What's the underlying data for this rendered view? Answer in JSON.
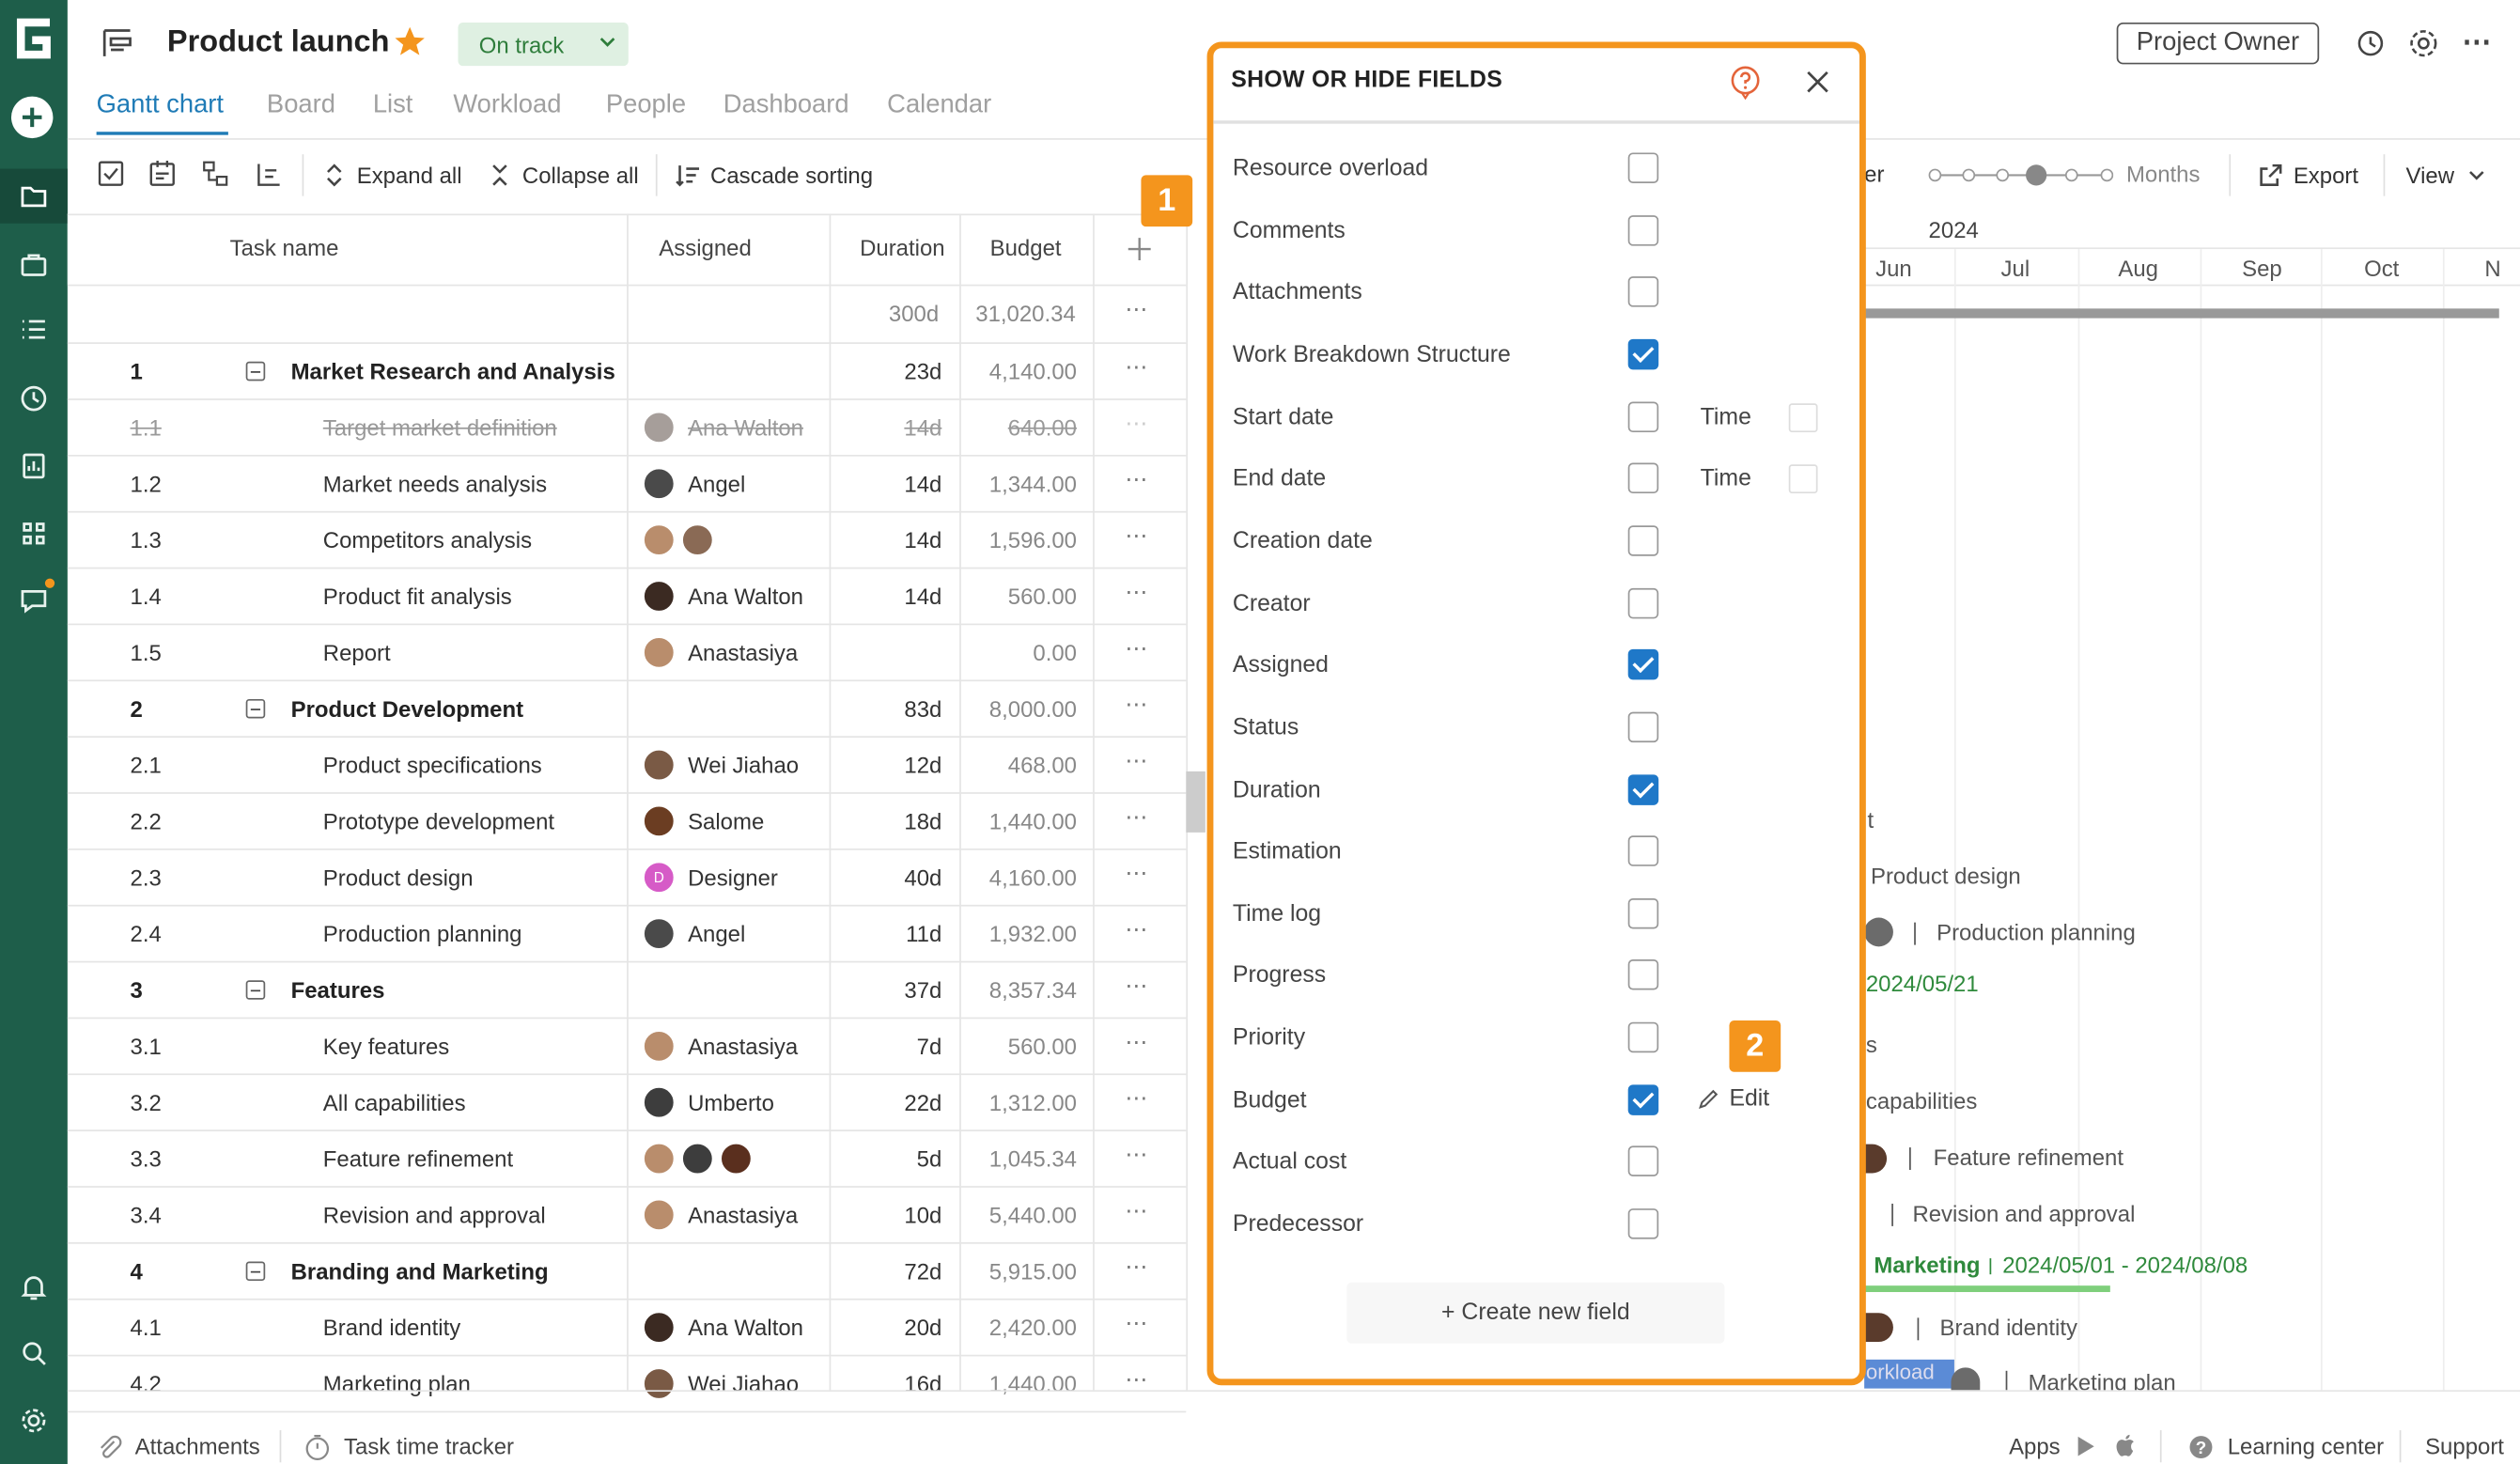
{
  "header": {
    "title": "Product launch",
    "status": "On track",
    "owner_button": "Project Owner"
  },
  "tabs": [
    "Gantt chart",
    "Board",
    "List",
    "Workload",
    "People",
    "Dashboard",
    "Calendar"
  ],
  "toolbar": {
    "expand_all": "Expand all",
    "collapse_all": "Collapse all",
    "cascade_sorting": "Cascade sorting",
    "export": "Export",
    "view": "View",
    "months": "Months",
    "filter_partial": "er"
  },
  "grid": {
    "columns": [
      "Task name",
      "Assigned",
      "Duration",
      "Budget"
    ],
    "summary": {
      "duration": "300d",
      "budget": "31,020.34"
    },
    "rows": [
      {
        "id": "1",
        "name": "Market Research and Analysis",
        "assigned": "",
        "duration": "23d",
        "budget": "4,140.00",
        "group": true
      },
      {
        "id": "1.1",
        "name": "Target market definition",
        "assigned": "Ana Walton",
        "duration": "14d",
        "budget": "640.00",
        "done": true
      },
      {
        "id": "1.2",
        "name": "Market needs analysis",
        "assigned": "Angel",
        "duration": "14d",
        "budget": "1,344.00"
      },
      {
        "id": "1.3",
        "name": "Competitors analysis",
        "assigned": "",
        "duration": "14d",
        "budget": "1,596.00"
      },
      {
        "id": "1.4",
        "name": "Product fit analysis",
        "assigned": "Ana Walton",
        "duration": "14d",
        "budget": "560.00"
      },
      {
        "id": "1.5",
        "name": "Report",
        "assigned": "Anastasiya",
        "duration": "",
        "budget": "0.00"
      },
      {
        "id": "2",
        "name": "Product Development",
        "assigned": "",
        "duration": "83d",
        "budget": "8,000.00",
        "group": true
      },
      {
        "id": "2.1",
        "name": "Product specifications",
        "assigned": "Wei Jiahao",
        "duration": "12d",
        "budget": "468.00"
      },
      {
        "id": "2.2",
        "name": "Prototype development",
        "assigned": "Salome",
        "duration": "18d",
        "budget": "1,440.00"
      },
      {
        "id": "2.3",
        "name": "Product design",
        "assigned": "Designer",
        "duration": "40d",
        "budget": "4,160.00"
      },
      {
        "id": "2.4",
        "name": "Production planning",
        "assigned": "Angel",
        "duration": "11d",
        "budget": "1,932.00"
      },
      {
        "id": "3",
        "name": "Features",
        "assigned": "",
        "duration": "37d",
        "budget": "8,357.34",
        "group": true
      },
      {
        "id": "3.1",
        "name": "Key features",
        "assigned": "Anastasiya",
        "duration": "7d",
        "budget": "560.00"
      },
      {
        "id": "3.2",
        "name": "All capabilities",
        "assigned": "Umberto",
        "duration": "22d",
        "budget": "1,312.00"
      },
      {
        "id": "3.3",
        "name": "Feature refinement",
        "assigned": "",
        "duration": "5d",
        "budget": "1,045.34"
      },
      {
        "id": "3.4",
        "name": "Revision and approval",
        "assigned": "Anastasiya",
        "duration": "10d",
        "budget": "5,440.00"
      },
      {
        "id": "4",
        "name": "Branding and Marketing",
        "assigned": "",
        "duration": "72d",
        "budget": "5,915.00",
        "group": true
      },
      {
        "id": "4.1",
        "name": "Brand identity",
        "assigned": "Ana Walton",
        "duration": "20d",
        "budget": "2,420.00"
      },
      {
        "id": "4.2",
        "name": "Marketing plan",
        "assigned": "Wei Jiahao",
        "duration": "16d",
        "budget": "1,440.00"
      }
    ]
  },
  "timeline": {
    "year": "2024",
    "months": [
      "Jun",
      "Jul",
      "Aug",
      "Sep",
      "Oct",
      "N"
    ],
    "labels": {
      "t1": "t",
      "product_design": "Product design",
      "production_planning": "Production planning",
      "date1": "2024/05/21",
      "s": "s",
      "capabilities": "capabilities",
      "feature_refinement": "Feature refinement",
      "revision": "Revision and approval",
      "marketing": "Marketing",
      "marketing_dates": "2024/05/01 - 2024/08/08",
      "brand_identity": "Brand identity",
      "workload_chip": "orkload",
      "marketing_plan": "Marketing plan"
    }
  },
  "dialog": {
    "title": "SHOW OR HIDE FIELDS",
    "time_label": "Time",
    "edit_label": "Edit",
    "create_field": "+ Create new field",
    "fields": [
      {
        "label": "Resource overload",
        "checked": false
      },
      {
        "label": "Comments",
        "checked": false
      },
      {
        "label": "Attachments",
        "checked": false
      },
      {
        "label": "Work Breakdown Structure",
        "checked": true
      },
      {
        "label": "Start date",
        "checked": false
      },
      {
        "label": "End date",
        "checked": false
      },
      {
        "label": "Creation date",
        "checked": false
      },
      {
        "label": "Creator",
        "checked": false
      },
      {
        "label": "Assigned",
        "checked": true
      },
      {
        "label": "Status",
        "checked": false
      },
      {
        "label": "Duration",
        "checked": true
      },
      {
        "label": "Estimation",
        "checked": false
      },
      {
        "label": "Time log",
        "checked": false
      },
      {
        "label": "Progress",
        "checked": false
      },
      {
        "label": "Priority",
        "checked": false
      },
      {
        "label": "Budget",
        "checked": true
      },
      {
        "label": "Actual cost",
        "checked": false
      },
      {
        "label": "Predecessor",
        "checked": false
      }
    ]
  },
  "markers": {
    "m1": "1",
    "m2": "2"
  },
  "footer": {
    "attachments": "Attachments",
    "task_time_tracker": "Task time tracker",
    "apps": "Apps",
    "learning_center": "Learning center",
    "support": "Support"
  },
  "colors": {
    "sidebar": "#1e5e4a",
    "accent_blue": "#1f7bb6",
    "highlight_orange": "#f4951d",
    "checkbox_blue": "#1f78c8",
    "status_green": "#2e7d3b",
    "timeline_green": "#2f8a3c"
  }
}
